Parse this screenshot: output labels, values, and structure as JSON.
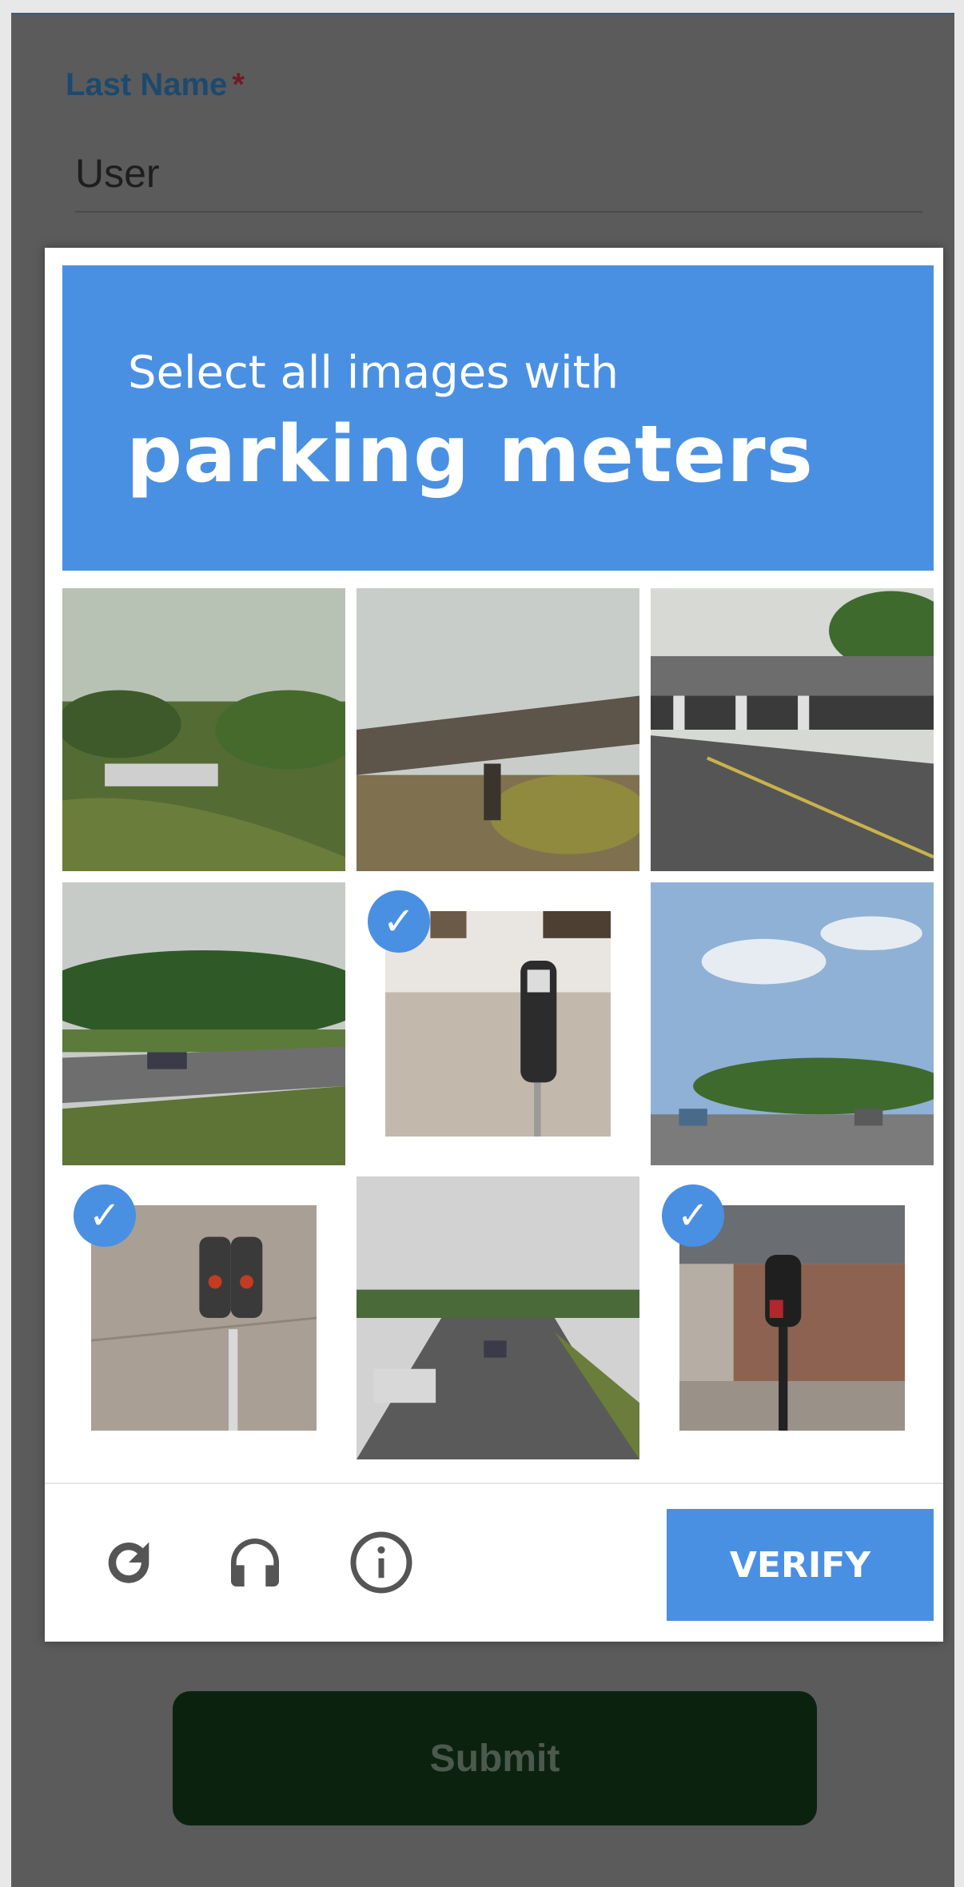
{
  "form": {
    "last_name_label": "Last Name",
    "required_marker": "*",
    "last_name_value": "User",
    "submit_label": "Submit"
  },
  "captcha": {
    "prompt_line1": "Select all images with",
    "prompt_target": "parking meters",
    "verify_label": "VERIFY",
    "check_glyph": "✓",
    "tiles": [
      {
        "content": "roadside hill with trees",
        "selected": false
      },
      {
        "content": "highway overpass",
        "selected": false
      },
      {
        "content": "bridge over road",
        "selected": false
      },
      {
        "content": "divided highway with cars",
        "selected": false
      },
      {
        "content": "parking meter",
        "selected": true
      },
      {
        "content": "street with sky",
        "selected": false
      },
      {
        "content": "double parking meter",
        "selected": true
      },
      {
        "content": "highway traffic",
        "selected": false
      },
      {
        "content": "parking meter by brick wall",
        "selected": true
      }
    ],
    "footer_icons": [
      "reload-icon",
      "audio-headphones-icon",
      "info-icon"
    ]
  },
  "colors": {
    "accent": "#4a90e2",
    "label": "#1c4a6e",
    "required": "#6e1c24",
    "overlay": "#5b5b5b",
    "submit_bg": "#0b220f"
  }
}
